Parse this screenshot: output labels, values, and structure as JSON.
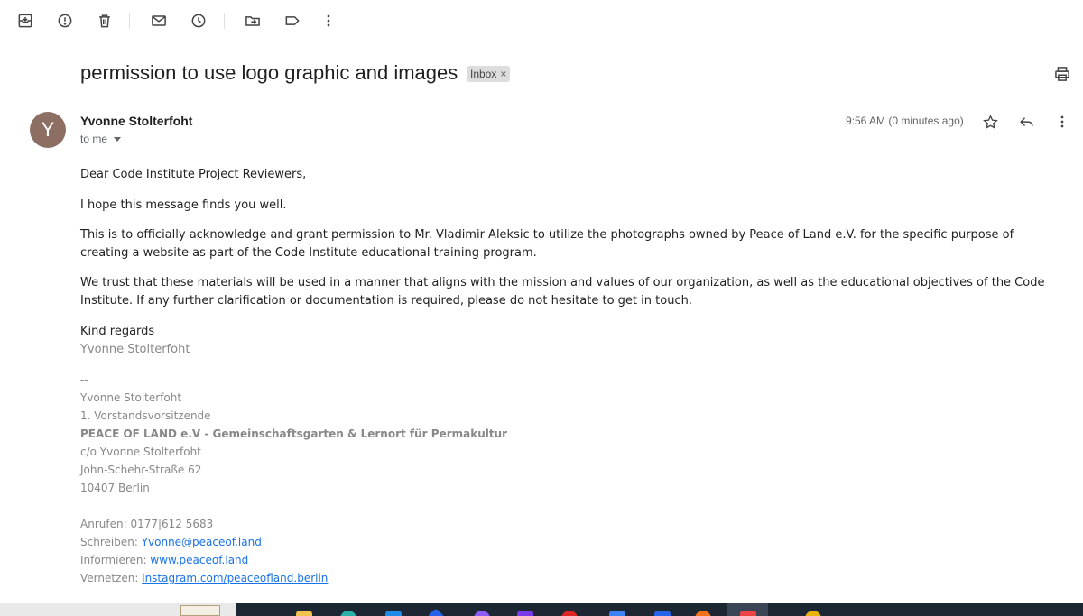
{
  "toolbar": {
    "icons": [
      "archive-icon",
      "report-spam-icon",
      "delete-icon",
      "mark-unread-icon",
      "snooze-icon",
      "move-to-icon",
      "label-icon",
      "more-vert-icon"
    ]
  },
  "email": {
    "subject": "permission to use logo graphic and images",
    "label_chip": "Inbox",
    "chip_close": "×",
    "sender_initial": "Y",
    "sender_name": "Yvonne Stolterfoht",
    "recipient": "to me",
    "timestamp": "9:56 AM (0 minutes ago)",
    "body": {
      "greeting": "Dear Code Institute Project Reviewers,",
      "line1": "I hope this message finds you well.",
      "para1": "This is to officially acknowledge and grant permission to Mr. Vladimir Aleksic to utilize the photographs owned by Peace of Land e.V. for the specific purpose of creating a website as part of the Code Institute educational training program.",
      "para2": "We trust that these materials will be used in a manner that aligns with the mission and values of our organization, as well as the educational objectives of the Code Institute. If any further clarification or documentation is required, please do not hesitate to get in touch.",
      "closing": "Kind regards",
      "closing_name": "Yvonne Stolterfoht"
    },
    "signature": {
      "dashes": "--",
      "name": "Yvonne Stolterfoht",
      "role": "1. Vorstandsvorsitzende",
      "org": "PEACE OF LAND e.V - Gemeinschaftsgarten & Lernort für Permakultur",
      "co": "c/o Yvonne Stolterfoht",
      "street": "John-Schehr-Straße 62",
      "city": "10407 Berlin",
      "phone_label": "Anrufen:",
      "phone": "0177|612 5683",
      "email_label": "Schreiben:",
      "email": "Yvonne@peaceof.land",
      "web_label": "Informieren:",
      "web": "www.peaceof.land",
      "social_label": "Vernetzen:",
      "social": "instagram.com/peaceofland.berlin"
    }
  },
  "colors": {
    "avatar": "#8d6e63",
    "link": "#1a73e8",
    "signature_text": "#888888",
    "taskbar": "#1d2733"
  }
}
